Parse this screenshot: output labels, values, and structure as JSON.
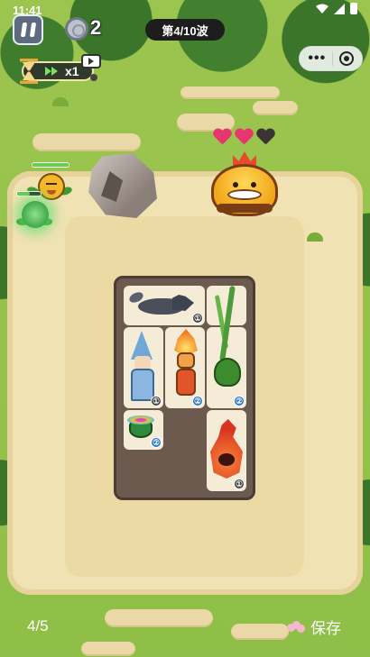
{
  "status_bar": {
    "time": "11:41"
  },
  "hud": {
    "coins": "2",
    "wave": "第4/10波",
    "speed": "x1"
  },
  "boss": {
    "hearts_full": 2,
    "hearts_total": 3
  },
  "colors": {
    "heart_full": "#e8356f",
    "heart_empty": "#3b3434",
    "accent_green": "#61d14a"
  },
  "enemies": [
    {
      "type": "sunflower",
      "hp": 1.0
    },
    {
      "type": "slime",
      "hp": 0.55
    }
  ],
  "board": {
    "cards": [
      {
        "unit": "wolf",
        "level": "①"
      },
      {
        "unit": "flame-warrior",
        "level": "②"
      },
      {
        "unit": "vine-plant",
        "level": "②"
      },
      {
        "unit": "ice-mage",
        "level": "①"
      },
      {
        "unit": "cauldron",
        "level": "②"
      },
      {
        "unit": "fire-spirit",
        "level": "①"
      }
    ]
  },
  "footer": {
    "page": "4/5",
    "save_label": "保存"
  }
}
